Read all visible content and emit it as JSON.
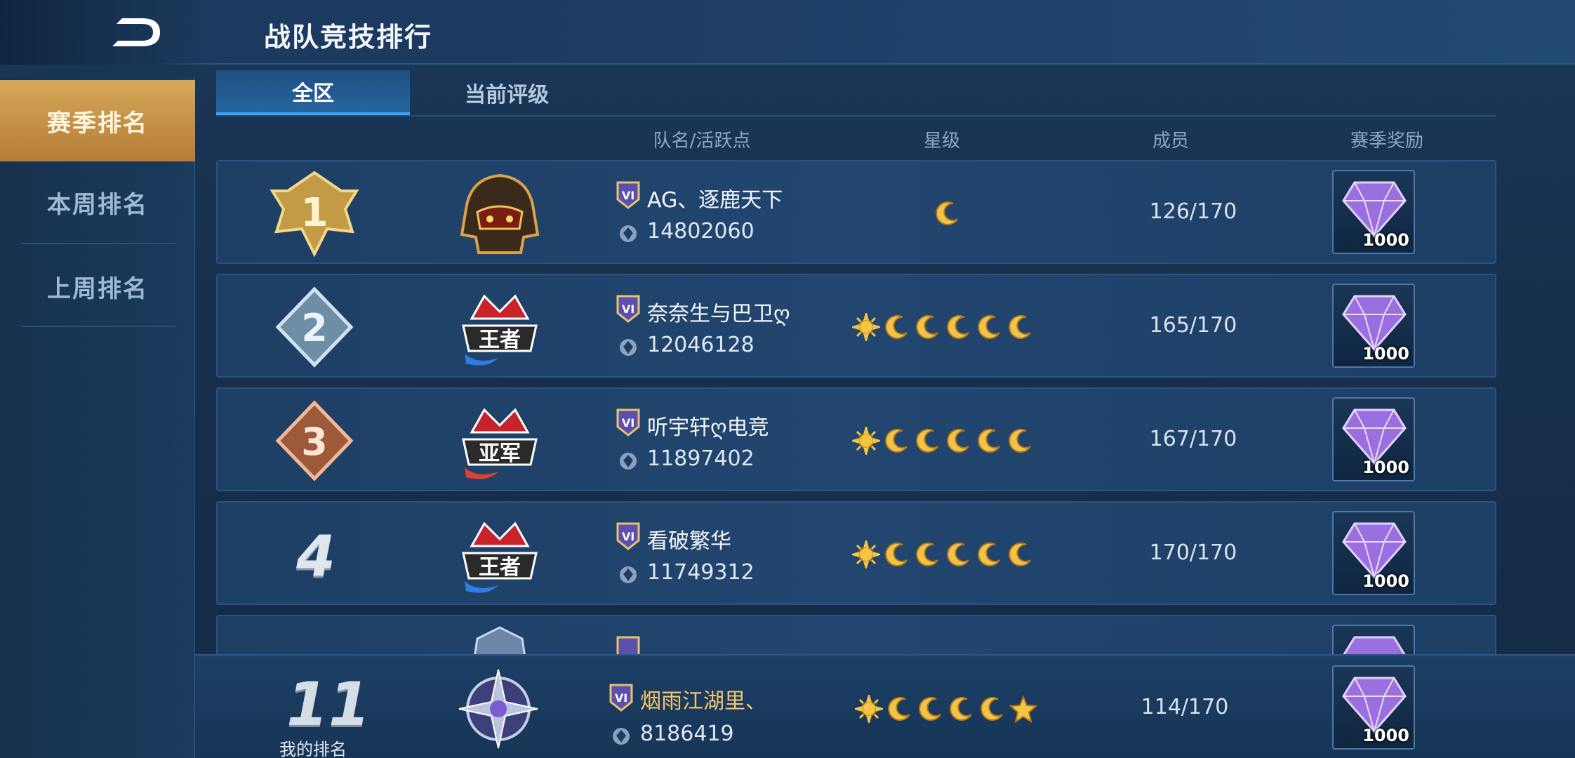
{
  "header": {
    "title": "战队竞技排行"
  },
  "sidebar": {
    "items": [
      {
        "label": "赛季排名",
        "active": true
      },
      {
        "label": "本周排名",
        "active": false
      },
      {
        "label": "上周排名",
        "active": false
      }
    ]
  },
  "tabs": [
    {
      "label": "全区",
      "active": true
    },
    {
      "label": "当前评级",
      "active": false
    }
  ],
  "columns": {
    "team": "队名/活跃点",
    "stars": "星级",
    "members": "成员",
    "reward": "赛季奖励"
  },
  "rows": [
    {
      "rank": "1",
      "rank_style": "gold-badge",
      "logo": "helmet-icon",
      "tier": "VI",
      "name": "AG、逐鹿天下",
      "points": "14802060",
      "stars": [
        "moon"
      ],
      "members": "126/170",
      "reward": "1000"
    },
    {
      "rank": "2",
      "rank_style": "silver-badge",
      "logo": "king-crown-icon",
      "tier": "VI",
      "name": "奈奈生与巴卫ღ",
      "points": "12046128",
      "stars": [
        "sun",
        "moon",
        "moon",
        "moon",
        "moon",
        "moon"
      ],
      "members": "165/170",
      "reward": "1000"
    },
    {
      "rank": "3",
      "rank_style": "bronze-badge",
      "logo": "runner-up-crown-icon",
      "tier": "VI",
      "name": "听宇轩ღ电竞",
      "points": "11897402",
      "stars": [
        "sun",
        "moon",
        "moon",
        "moon",
        "moon",
        "moon"
      ],
      "members": "167/170",
      "reward": "1000"
    },
    {
      "rank": "4",
      "rank_style": "plain",
      "logo": "king-crown-icon",
      "tier": "VI",
      "name": "看破繁华",
      "points": "11749312",
      "stars": [
        "sun",
        "moon",
        "moon",
        "moon",
        "moon",
        "moon"
      ],
      "members": "170/170",
      "reward": "1000"
    }
  ],
  "my_rank": {
    "rank": "11",
    "label": "我的排名",
    "logo": "compass-star-icon",
    "tier": "VI",
    "name": "烟雨江湖里、",
    "points": "8186419",
    "stars": [
      "sun",
      "moon",
      "moon",
      "moon",
      "moon",
      "star"
    ],
    "members": "114/170",
    "reward": "1000"
  },
  "colors": {
    "accent_gold": "#d7a85a",
    "tab_active_underline": "#39a6ff",
    "my_team_name": "#f5c76a"
  }
}
